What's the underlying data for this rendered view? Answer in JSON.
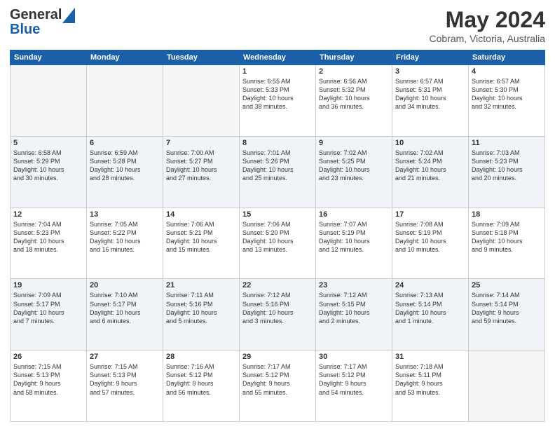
{
  "header": {
    "logo_general": "General",
    "logo_blue": "Blue",
    "month": "May 2024",
    "location": "Cobram, Victoria, Australia"
  },
  "days_of_week": [
    "Sunday",
    "Monday",
    "Tuesday",
    "Wednesday",
    "Thursday",
    "Friday",
    "Saturday"
  ],
  "weeks": [
    {
      "shaded": false,
      "days": [
        {
          "num": "",
          "info": ""
        },
        {
          "num": "",
          "info": ""
        },
        {
          "num": "",
          "info": ""
        },
        {
          "num": "1",
          "info": "Sunrise: 6:55 AM\nSunset: 5:33 PM\nDaylight: 10 hours\nand 38 minutes."
        },
        {
          "num": "2",
          "info": "Sunrise: 6:56 AM\nSunset: 5:32 PM\nDaylight: 10 hours\nand 36 minutes."
        },
        {
          "num": "3",
          "info": "Sunrise: 6:57 AM\nSunset: 5:31 PM\nDaylight: 10 hours\nand 34 minutes."
        },
        {
          "num": "4",
          "info": "Sunrise: 6:57 AM\nSunset: 5:30 PM\nDaylight: 10 hours\nand 32 minutes."
        }
      ]
    },
    {
      "shaded": true,
      "days": [
        {
          "num": "5",
          "info": "Sunrise: 6:58 AM\nSunset: 5:29 PM\nDaylight: 10 hours\nand 30 minutes."
        },
        {
          "num": "6",
          "info": "Sunrise: 6:59 AM\nSunset: 5:28 PM\nDaylight: 10 hours\nand 28 minutes."
        },
        {
          "num": "7",
          "info": "Sunrise: 7:00 AM\nSunset: 5:27 PM\nDaylight: 10 hours\nand 27 minutes."
        },
        {
          "num": "8",
          "info": "Sunrise: 7:01 AM\nSunset: 5:26 PM\nDaylight: 10 hours\nand 25 minutes."
        },
        {
          "num": "9",
          "info": "Sunrise: 7:02 AM\nSunset: 5:25 PM\nDaylight: 10 hours\nand 23 minutes."
        },
        {
          "num": "10",
          "info": "Sunrise: 7:02 AM\nSunset: 5:24 PM\nDaylight: 10 hours\nand 21 minutes."
        },
        {
          "num": "11",
          "info": "Sunrise: 7:03 AM\nSunset: 5:23 PM\nDaylight: 10 hours\nand 20 minutes."
        }
      ]
    },
    {
      "shaded": false,
      "days": [
        {
          "num": "12",
          "info": "Sunrise: 7:04 AM\nSunset: 5:23 PM\nDaylight: 10 hours\nand 18 minutes."
        },
        {
          "num": "13",
          "info": "Sunrise: 7:05 AM\nSunset: 5:22 PM\nDaylight: 10 hours\nand 16 minutes."
        },
        {
          "num": "14",
          "info": "Sunrise: 7:06 AM\nSunset: 5:21 PM\nDaylight: 10 hours\nand 15 minutes."
        },
        {
          "num": "15",
          "info": "Sunrise: 7:06 AM\nSunset: 5:20 PM\nDaylight: 10 hours\nand 13 minutes."
        },
        {
          "num": "16",
          "info": "Sunrise: 7:07 AM\nSunset: 5:19 PM\nDaylight: 10 hours\nand 12 minutes."
        },
        {
          "num": "17",
          "info": "Sunrise: 7:08 AM\nSunset: 5:19 PM\nDaylight: 10 hours\nand 10 minutes."
        },
        {
          "num": "18",
          "info": "Sunrise: 7:09 AM\nSunset: 5:18 PM\nDaylight: 10 hours\nand 9 minutes."
        }
      ]
    },
    {
      "shaded": true,
      "days": [
        {
          "num": "19",
          "info": "Sunrise: 7:09 AM\nSunset: 5:17 PM\nDaylight: 10 hours\nand 7 minutes."
        },
        {
          "num": "20",
          "info": "Sunrise: 7:10 AM\nSunset: 5:17 PM\nDaylight: 10 hours\nand 6 minutes."
        },
        {
          "num": "21",
          "info": "Sunrise: 7:11 AM\nSunset: 5:16 PM\nDaylight: 10 hours\nand 5 minutes."
        },
        {
          "num": "22",
          "info": "Sunrise: 7:12 AM\nSunset: 5:16 PM\nDaylight: 10 hours\nand 3 minutes."
        },
        {
          "num": "23",
          "info": "Sunrise: 7:12 AM\nSunset: 5:15 PM\nDaylight: 10 hours\nand 2 minutes."
        },
        {
          "num": "24",
          "info": "Sunrise: 7:13 AM\nSunset: 5:14 PM\nDaylight: 10 hours\nand 1 minute."
        },
        {
          "num": "25",
          "info": "Sunrise: 7:14 AM\nSunset: 5:14 PM\nDaylight: 9 hours\nand 59 minutes."
        }
      ]
    },
    {
      "shaded": false,
      "days": [
        {
          "num": "26",
          "info": "Sunrise: 7:15 AM\nSunset: 5:13 PM\nDaylight: 9 hours\nand 58 minutes."
        },
        {
          "num": "27",
          "info": "Sunrise: 7:15 AM\nSunset: 5:13 PM\nDaylight: 9 hours\nand 57 minutes."
        },
        {
          "num": "28",
          "info": "Sunrise: 7:16 AM\nSunset: 5:12 PM\nDaylight: 9 hours\nand 56 minutes."
        },
        {
          "num": "29",
          "info": "Sunrise: 7:17 AM\nSunset: 5:12 PM\nDaylight: 9 hours\nand 55 minutes."
        },
        {
          "num": "30",
          "info": "Sunrise: 7:17 AM\nSunset: 5:12 PM\nDaylight: 9 hours\nand 54 minutes."
        },
        {
          "num": "31",
          "info": "Sunrise: 7:18 AM\nSunset: 5:11 PM\nDaylight: 9 hours\nand 53 minutes."
        },
        {
          "num": "",
          "info": ""
        }
      ]
    }
  ]
}
